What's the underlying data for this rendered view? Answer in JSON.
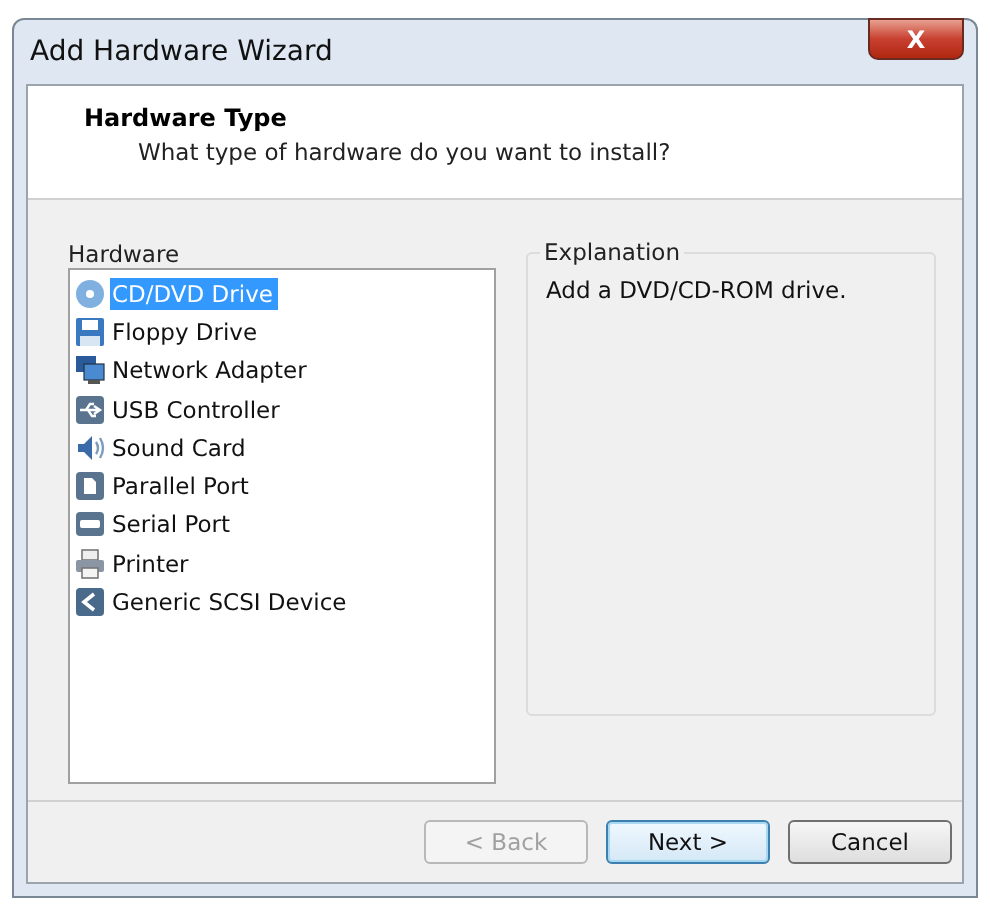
{
  "window": {
    "title": "Add Hardware Wizard",
    "close": "X"
  },
  "header": {
    "title": "Hardware Type",
    "subtitle": "What type of hardware do you want to install?"
  },
  "hardware": {
    "label": "Hardware",
    "items": [
      {
        "label": "CD/DVD Drive",
        "kind": "disc",
        "selected": true
      },
      {
        "label": "Floppy Drive",
        "kind": "floppy",
        "selected": false
      },
      {
        "label": "Network Adapter",
        "kind": "network",
        "selected": false
      },
      {
        "label": "USB Controller",
        "kind": "usb",
        "selected": false
      },
      {
        "label": "Sound Card",
        "kind": "sound",
        "selected": false
      },
      {
        "label": "Parallel Port",
        "kind": "parallel",
        "selected": false
      },
      {
        "label": "Serial Port",
        "kind": "serial",
        "selected": false
      },
      {
        "label": "Printer",
        "kind": "printer",
        "selected": false
      },
      {
        "label": "Generic SCSI Device",
        "kind": "scsi",
        "selected": false
      }
    ]
  },
  "explanation": {
    "label": "Explanation",
    "text": "Add a DVD/CD-ROM drive."
  },
  "buttons": [
    {
      "label": "< Back",
      "disabled": true,
      "default": false
    },
    {
      "label": "Next >",
      "disabled": false,
      "default": true
    },
    {
      "label": "Cancel",
      "disabled": false,
      "default": false
    }
  ]
}
